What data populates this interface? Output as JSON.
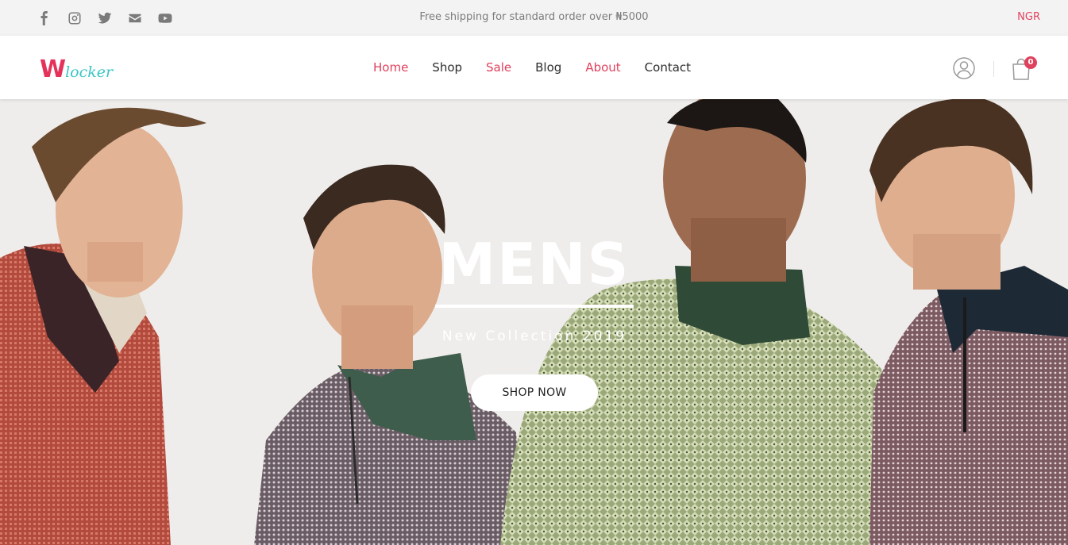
{
  "topbar": {
    "social_icons": [
      "facebook-icon",
      "instagram-icon",
      "twitter-icon",
      "mail-icon",
      "youtube-icon"
    ],
    "shipping_text": "Free shipping for standard order over ₦5000",
    "currency": "NGR"
  },
  "header": {
    "logo": {
      "first_letter": "W",
      "rest": "locker"
    },
    "nav": [
      {
        "label": "Home",
        "active": true
      },
      {
        "label": "Shop",
        "active": false
      },
      {
        "label": "Sale",
        "active": true
      },
      {
        "label": "Blog",
        "active": false
      },
      {
        "label": "About",
        "active": true
      },
      {
        "label": "Contact",
        "active": false
      }
    ],
    "cart_count": "0"
  },
  "hero": {
    "title": "MENS",
    "subtitle": "New Collection 2019",
    "button_label": "SHOP NOW"
  },
  "colors": {
    "accent": "#e0415d",
    "logo_teal": "#3cc6c7",
    "topbar_bg": "#f3f3f3",
    "hero_bg": "#efedeb"
  }
}
